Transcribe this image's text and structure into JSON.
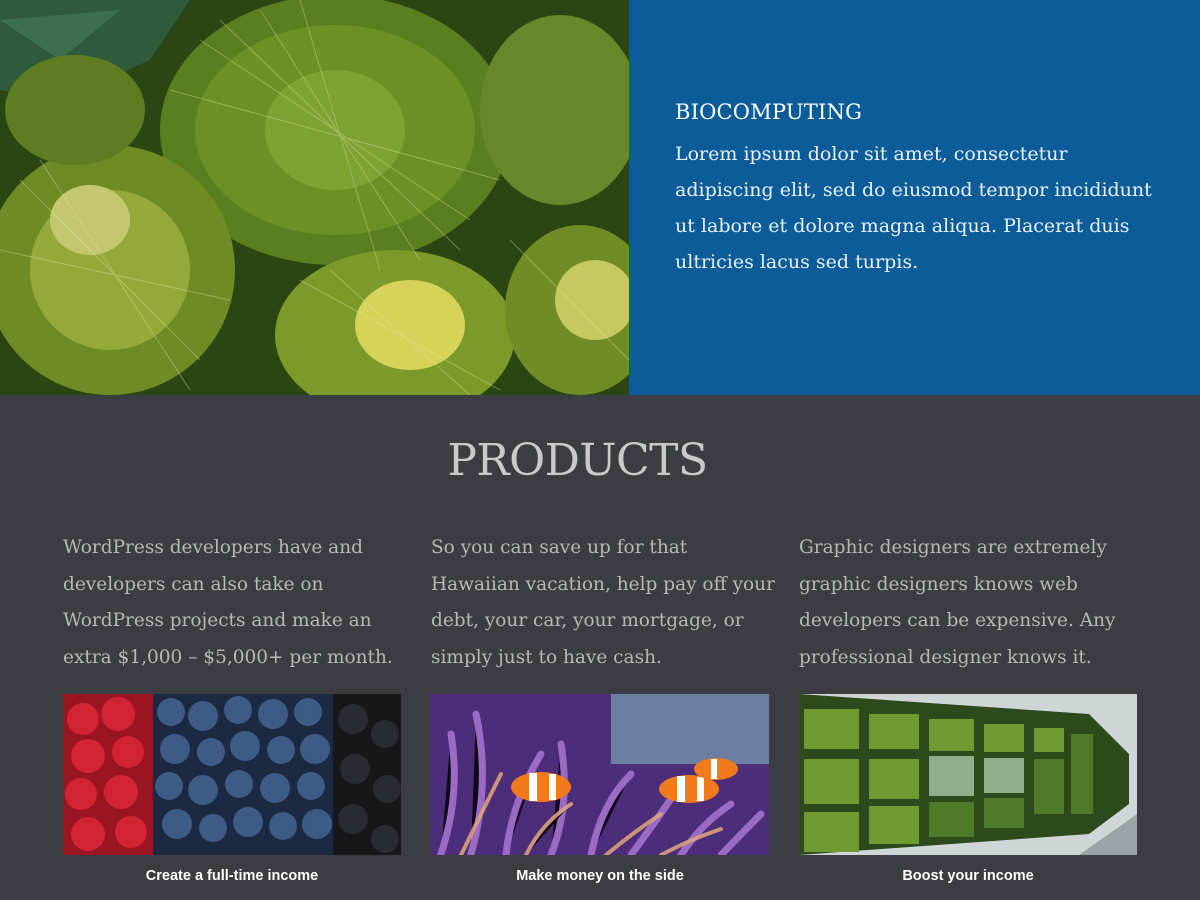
{
  "hero": {
    "heading": "BIOCOMPUTING",
    "body": "Lorem ipsum dolor sit amet, consectetur adipiscing elit, sed do eiusmod tempor incididunt ut labore et dolore magna aliqua. Placerat duis ultricies lacus sed turpis.",
    "panel_color": "#0b5c98",
    "image_icon": "cactus-photo"
  },
  "products": {
    "title": "PRODUCTS",
    "items": [
      {
        "text": " WordPress developers have and developers can also take on WordPress projects and make an extra $1,000 – $5,000+ per month.",
        "image_icon": "berries-photo",
        "caption": "Create a full-time income"
      },
      {
        "text": " So you can save up for that Hawaiian vacation, help pay off your debt, your car, your mortgage, or simply just to have cash.",
        "image_icon": "clownfish-photo",
        "caption": "Make money on the side"
      },
      {
        "text": " Graphic designers are extremely graphic designers knows web developers can be expensive. Any professional designer knows it.",
        "image_icon": "green-wall-photo",
        "caption": "Boost your income"
      }
    ]
  }
}
